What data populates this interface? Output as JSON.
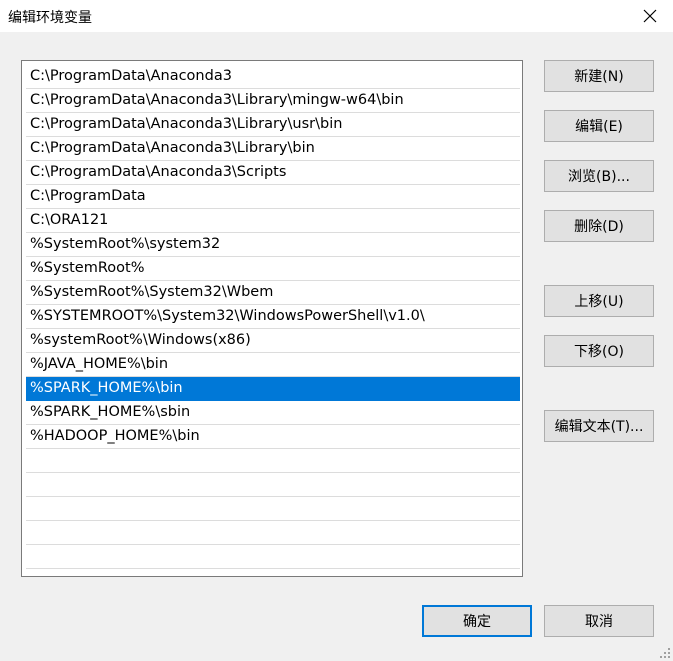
{
  "window": {
    "title": "编辑环境变量",
    "close_icon": "close-icon"
  },
  "list": {
    "items": [
      "C:\\ProgramData\\Anaconda3",
      "C:\\ProgramData\\Anaconda3\\Library\\mingw-w64\\bin",
      "C:\\ProgramData\\Anaconda3\\Library\\usr\\bin",
      "C:\\ProgramData\\Anaconda3\\Library\\bin",
      "C:\\ProgramData\\Anaconda3\\Scripts",
      "C:\\ProgramData",
      "C:\\ORA121",
      "%SystemRoot%\\system32",
      "%SystemRoot%",
      "%SystemRoot%\\System32\\Wbem",
      "%SYSTEMROOT%\\System32\\WindowsPowerShell\\v1.0\\",
      "%systemRoot%\\Windows(x86)",
      "%JAVA_HOME%\\bin",
      "%SPARK_HOME%\\bin",
      "%SPARK_HOME%\\sbin",
      "%HADOOP_HOME%\\bin",
      "",
      "",
      "",
      "",
      "",
      ""
    ],
    "selected_index": 13,
    "selection_color": "#0078d7"
  },
  "buttons": {
    "new": "新建(N)",
    "edit": "编辑(E)",
    "browse": "浏览(B)...",
    "delete": "删除(D)",
    "move_up": "上移(U)",
    "move_down": "下移(O)",
    "edit_text": "编辑文本(T)...",
    "ok": "确定",
    "cancel": "取消"
  },
  "colors": {
    "accent": "#0078d7",
    "background": "#f0f0f0",
    "button_face": "#e1e1e1"
  }
}
